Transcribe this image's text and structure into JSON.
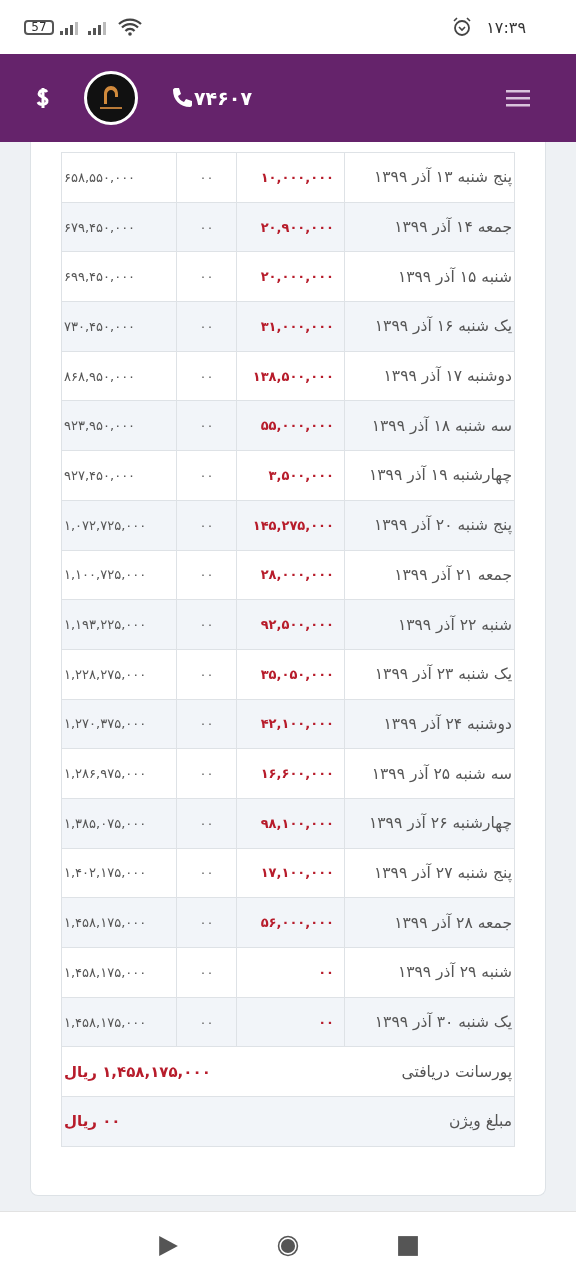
{
  "status_bar": {
    "battery": "57",
    "time": "۱۷:۳۹"
  },
  "header": {
    "phone": "۷۴۶۰۷"
  },
  "table": {
    "rows": [
      {
        "date": "پنج شنبه ۱۳ آذر ۱۳۹۹",
        "amount": "۱۰,۰۰۰,۰۰۰",
        "column_3": "۰۰",
        "total": "۶۵۸,۵۵۰,۰۰۰"
      },
      {
        "date": "جمعه ۱۴ آذر ۱۳۹۹",
        "amount": "۲۰,۹۰۰,۰۰۰",
        "column_3": "۰۰",
        "total": "۶۷۹,۴۵۰,۰۰۰"
      },
      {
        "date": "شنبه ۱۵ آذر ۱۳۹۹",
        "amount": "۲۰,۰۰۰,۰۰۰",
        "column_3": "۰۰",
        "total": "۶۹۹,۴۵۰,۰۰۰"
      },
      {
        "date": "یک شنبه ۱۶ آذر ۱۳۹۹",
        "amount": "۳۱,۰۰۰,۰۰۰",
        "column_3": "۰۰",
        "total": "۷۳۰,۴۵۰,۰۰۰"
      },
      {
        "date": "دوشنبه ۱۷ آذر ۱۳۹۹",
        "amount": "۱۳۸,۵۰۰,۰۰۰",
        "column_3": "۰۰",
        "total": "۸۶۸,۹۵۰,۰۰۰"
      },
      {
        "date": "سه شنبه ۱۸ آذر ۱۳۹۹",
        "amount": "۵۵,۰۰۰,۰۰۰",
        "column_3": "۰۰",
        "total": "۹۲۳,۹۵۰,۰۰۰"
      },
      {
        "date": "چهارشنبه ۱۹ آذر ۱۳۹۹",
        "amount": "۳,۵۰۰,۰۰۰",
        "column_3": "۰۰",
        "total": "۹۲۷,۴۵۰,۰۰۰"
      },
      {
        "date": "پنج شنبه ۲۰ آذر ۱۳۹۹",
        "amount": "۱۴۵,۲۷۵,۰۰۰",
        "column_3": "۰۰",
        "total": "۱,۰۷۲,۷۲۵,۰۰۰"
      },
      {
        "date": "جمعه ۲۱ آذر ۱۳۹۹",
        "amount": "۲۸,۰۰۰,۰۰۰",
        "column_3": "۰۰",
        "total": "۱,۱۰۰,۷۲۵,۰۰۰"
      },
      {
        "date": "شنبه ۲۲ آذر ۱۳۹۹",
        "amount": "۹۲,۵۰۰,۰۰۰",
        "column_3": "۰۰",
        "total": "۱,۱۹۳,۲۲۵,۰۰۰"
      },
      {
        "date": "یک شنبه ۲۳ آذر ۱۳۹۹",
        "amount": "۳۵,۰۵۰,۰۰۰",
        "column_3": "۰۰",
        "total": "۱,۲۲۸,۲۷۵,۰۰۰"
      },
      {
        "date": "دوشنبه ۲۴ آذر ۱۳۹۹",
        "amount": "۴۲,۱۰۰,۰۰۰",
        "column_3": "۰۰",
        "total": "۱,۲۷۰,۳۷۵,۰۰۰"
      },
      {
        "date": "سه شنبه ۲۵ آذر ۱۳۹۹",
        "amount": "۱۶,۶۰۰,۰۰۰",
        "column_3": "۰۰",
        "total": "۱,۲۸۶,۹۷۵,۰۰۰"
      },
      {
        "date": "چهارشنبه ۲۶ آذر ۱۳۹۹",
        "amount": "۹۸,۱۰۰,۰۰۰",
        "column_3": "۰۰",
        "total": "۱,۳۸۵,۰۷۵,۰۰۰"
      },
      {
        "date": "پنج شنبه ۲۷ آذر ۱۳۹۹",
        "amount": "۱۷,۱۰۰,۰۰۰",
        "column_3": "۰۰",
        "total": "۱,۴۰۲,۱۷۵,۰۰۰"
      },
      {
        "date": "جمعه ۲۸ آذر ۱۳۹۹",
        "amount": "۵۶,۰۰۰,۰۰۰",
        "column_3": "۰۰",
        "total": "۱,۴۵۸,۱۷۵,۰۰۰"
      },
      {
        "date": "شنبه ۲۹ آذر ۱۳۹۹",
        "amount": "۰۰",
        "column_3": "۰۰",
        "total": "۱,۴۵۸,۱۷۵,۰۰۰"
      },
      {
        "date": "یک شنبه ۳۰ آذر ۱۳۹۹",
        "amount": "۰۰",
        "column_3": "۰۰",
        "total": "۱,۴۵۸,۱۷۵,۰۰۰"
      }
    ],
    "summary": [
      {
        "label": "پورسانت دریافتی",
        "value": "۱,۴۵۸,۱۷۵,۰۰۰ ریال"
      },
      {
        "label": "مبلغ ویژن",
        "value": "۰۰ ریال"
      }
    ]
  }
}
